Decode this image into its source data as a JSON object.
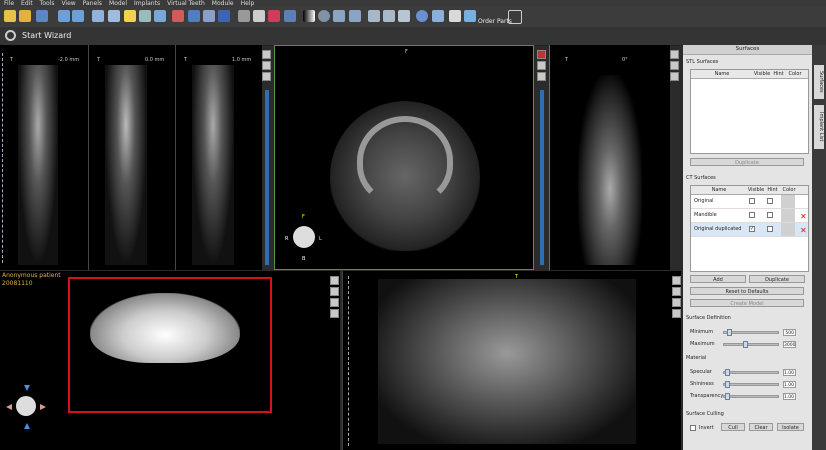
{
  "menu": [
    "File",
    "Edit",
    "Tools",
    "View",
    "Panels",
    "Model",
    "Implants",
    "Virtual Teeth",
    "Module",
    "Help"
  ],
  "toolbar": {
    "order_parts_label": "Order Parts"
  },
  "wizard": {
    "label": "Start Wizard"
  },
  "views": {
    "cross1": {
      "top_left": "T",
      "offset": "-2.0 mm"
    },
    "cross2": {
      "top_left": "T",
      "offset": "0.0 mm"
    },
    "cross3": {
      "top_left": "T",
      "offset": "1.0 mm"
    },
    "axial": {
      "top": "F",
      "orient_f": "F",
      "orient_r": "R",
      "orient_l": "L",
      "orient_b": "B"
    },
    "coronal": {
      "top_left": "T",
      "top_right": "0°"
    },
    "patient": {
      "name": "Anonymous patient",
      "date": "20081110"
    },
    "pano": {
      "top": "T"
    }
  },
  "surfaces_panel": {
    "title": "Surfaces",
    "stl_section": "STL Surfaces",
    "stl_columns": [
      "Name",
      "Visible",
      "Hint",
      "Color"
    ],
    "stl_duplicate": "Duplicate",
    "ct_section": "CT Surfaces",
    "ct_columns": [
      "Name",
      "Visible",
      "Hint",
      "Color"
    ],
    "ct_rows": [
      {
        "name": "Original",
        "visible": false,
        "hint": false,
        "deletable": false
      },
      {
        "name": "Mandible",
        "visible": false,
        "hint": false,
        "deletable": true
      },
      {
        "name": "Original duplicated",
        "visible": true,
        "hint": false,
        "deletable": true
      }
    ],
    "add_label": "Add",
    "duplicate_label": "Duplicate",
    "reset_label": "Reset to Defaults",
    "create_model_label": "Create Model",
    "surface_def_section": "Surface Definition",
    "minimum_label": "Minimum",
    "minimum_value": "500",
    "maximum_label": "Maximum",
    "maximum_value": "3000",
    "material_section": "Material",
    "specular_label": "Specular",
    "specular_value": "1.00",
    "shininess_label": "Shininess",
    "shininess_value": "1.00",
    "transparency_label": "Transparency",
    "transparency_value": "1.00",
    "culling_section": "Surface Culling",
    "invert_label": "Invert",
    "cull_label": "Cull",
    "clear_label": "Clear",
    "isolate_label": "Isolate"
  },
  "side_tabs": [
    "Surfaces",
    "Implant List"
  ],
  "colors": {
    "accent_blue": "#2d6fb0",
    "highlight_red": "#d4121a",
    "axial_border": "#5a8f3a"
  }
}
